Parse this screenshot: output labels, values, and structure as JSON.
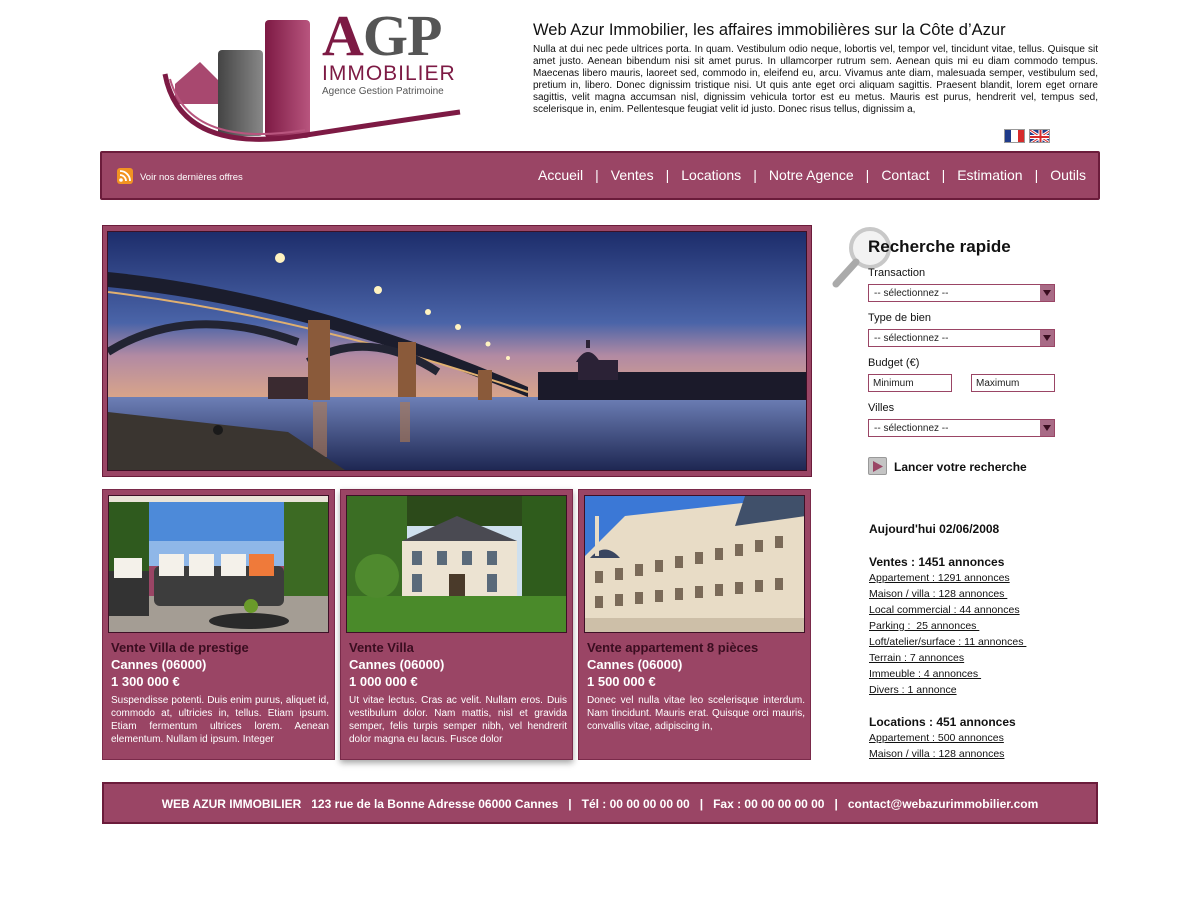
{
  "logo": {
    "agp_a": "A",
    "agp_gp": "GP",
    "immobilier": "IMMOBILIER",
    "agence": "Agence Gestion Patrimoine"
  },
  "header": {
    "title": "Web Azur Immobilier, les affaires immobilières sur la Côte d’Azur",
    "text": "Nulla at dui nec pede ultrices porta. In quam. Vestibulum odio neque, lobortis vel, tempor vel, tincidunt vitae, tellus. Quisque sit amet justo. Aenean bibendum nisi sit amet purus. In ullamcorper rutrum sem. Aenean quis mi eu diam commodo tempus. Maecenas libero mauris, laoreet sed, commodo in, eleifend eu, arcu. Vivamus ante diam, malesuada semper, vestibulum sed, pretium in, libero. Donec dignissim tristique nisi. Ut quis ante eget orci aliquam sagittis. Praesent blandit, lorem eget ornare sagittis, velit magna accumsan nisl, dignissim vehicula tortor est eu metus. Mauris est purus, hendrerit vel, tempus sed, scelerisque in, enim. Pellentesque feugiat velit id justo. Donec risus tellus, dignissim a,"
  },
  "nav": {
    "offers_label": "Voir nos dernières offres",
    "separator": "|",
    "items": [
      "Accueil",
      "Ventes",
      "Locations",
      "Notre Agence",
      "Contact",
      "Estimation",
      "Outils"
    ]
  },
  "listings": [
    {
      "title": "Vente Villa de prestige",
      "city": "Cannes (06000)",
      "price": "1 300 000 €",
      "desc": "Suspendisse potenti. Duis enim purus, aliquet id, commodo at, ultricies in, tellus. Etiam ipsum. Etiam fermentum ultrices lorem. Aenean elementum. Nullam id ipsum. Integer"
    },
    {
      "title": "Vente Villa",
      "city": "Cannes (06000)",
      "price": "1 000 000 €",
      "desc": "Ut vitae lectus. Cras ac velit. Nullam eros. Duis vestibulum dolor. Nam mattis, nisl et gravida semper, felis turpis semper nibh, vel hendrerit dolor magna eu lacus. Fusce dolor"
    },
    {
      "title": "Vente appartement 8 pièces",
      "city": "Cannes (06000)",
      "price": "1 500 000 €",
      "desc": "Donec vel nulla vitae leo scelerisque interdum. Nam tincidunt. Mauris erat. Quisque orci mauris, convallis vitae, adipiscing in,"
    }
  ],
  "search": {
    "title": "Recherche rapide",
    "transaction_label": "Transaction",
    "transaction_value": "-- sélectionnez --",
    "type_label": "Type de bien",
    "type_value": "-- sélectionnez --",
    "budget_label": "Budget (€)",
    "min_placeholder": "Minimum",
    "max_placeholder": "Maximum",
    "villes_label": "Villes",
    "villes_value": "-- sélectionnez --",
    "launch_label": "Lancer votre recherche"
  },
  "stats": {
    "date": "Aujourd'hui 02/06/2008",
    "ventes_head": "Ventes : 1451 annonces",
    "ventes": [
      "Appartement : 1291 annonces",
      "Maison / villa : 128 annonces ",
      "Local commercial : 44 annonces",
      "Parking :  25 annonces ",
      "Loft/atelier/surface : 11 annonces ",
      "Terrain : 7 annonces",
      "Immeuble : 4 annonces ",
      "Divers : 1 annonce"
    ],
    "locations_head": "Locations : 451 annonces",
    "locations": [
      "Appartement : 500 annonces",
      "Maison / villa : 128 annonces"
    ]
  },
  "footer": {
    "text": "WEB AZUR IMMOBILIER   123 rue de la Bonne Adresse 06000 Cannes   |   Tél : 00 00 00 00 00   |   Fax : 00 00 00 00 00   |   contact@webazurimmobilier.com"
  },
  "colors": {
    "brand": "#9a4565",
    "brand_dark": "#6b1c3b",
    "logo_accent": "#7d1a44",
    "rss": "#f29322"
  }
}
